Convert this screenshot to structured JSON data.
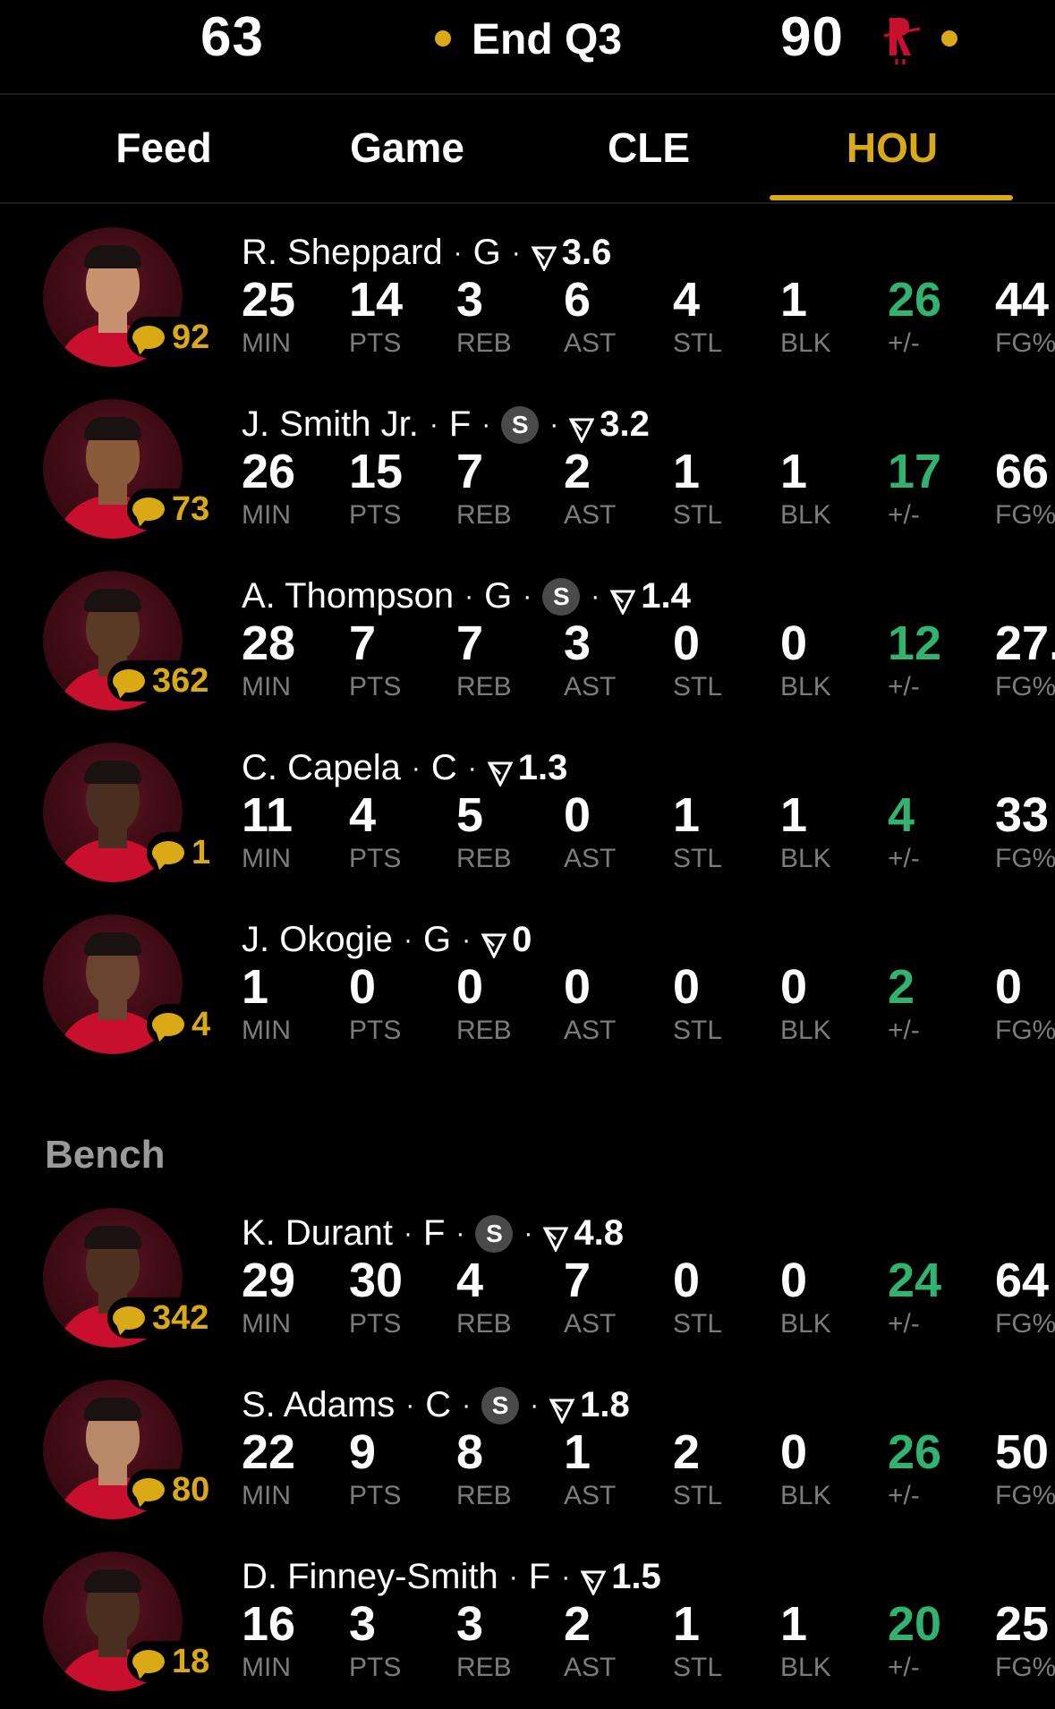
{
  "score": {
    "away": "63",
    "home": "90",
    "period": "End Q3"
  },
  "colors": {
    "accent": "#d9a916",
    "positive": "#2fb36e",
    "label": "#7c7c7c",
    "jersey": "#c8102e"
  },
  "icons": {
    "team_logo": "rockets-logo-icon",
    "comment": "speech-bubble-icon",
    "rating": "rating-flag-icon",
    "starter": "s-badge"
  },
  "tabs": [
    {
      "label": "Feed"
    },
    {
      "label": "Game"
    },
    {
      "label": "CLE"
    },
    {
      "label": "HOU",
      "active": true
    }
  ],
  "stat_labels": [
    "MIN",
    "PTS",
    "REB",
    "AST",
    "STL",
    "BLK",
    "+/-",
    "FG%"
  ],
  "bench_label": "Bench",
  "starters": [
    {
      "name": "R. Sheppard",
      "pos": "G",
      "badge": "",
      "rating": "3.6",
      "comments": "92",
      "stats": [
        "25",
        "14",
        "3",
        "6",
        "4",
        "1",
        "26",
        "44"
      ]
    },
    {
      "name": "J. Smith Jr.",
      "pos": "F",
      "badge": "S",
      "rating": "3.2",
      "comments": "73",
      "stats": [
        "26",
        "15",
        "7",
        "2",
        "1",
        "1",
        "17",
        "66"
      ]
    },
    {
      "name": "A. Thompson",
      "pos": "G",
      "badge": "S",
      "rating": "1.4",
      "comments": "362",
      "stats": [
        "28",
        "7",
        "7",
        "3",
        "0",
        "0",
        "12",
        "27."
      ]
    },
    {
      "name": "C. Capela",
      "pos": "C",
      "badge": "",
      "rating": "1.3",
      "comments": "1",
      "stats": [
        "11",
        "4",
        "5",
        "0",
        "1",
        "1",
        "4",
        "33"
      ]
    },
    {
      "name": "J. Okogie",
      "pos": "G",
      "badge": "",
      "rating": "0",
      "comments": "4",
      "stats": [
        "1",
        "0",
        "0",
        "0",
        "0",
        "0",
        "2",
        "0"
      ]
    }
  ],
  "bench": [
    {
      "name": "K. Durant",
      "pos": "F",
      "badge": "S",
      "rating": "4.8",
      "comments": "342",
      "stats": [
        "29",
        "30",
        "4",
        "7",
        "0",
        "0",
        "24",
        "64"
      ]
    },
    {
      "name": "S. Adams",
      "pos": "C",
      "badge": "S",
      "rating": "1.8",
      "comments": "80",
      "stats": [
        "22",
        "9",
        "8",
        "1",
        "2",
        "0",
        "26",
        "50"
      ]
    },
    {
      "name": "D. Finney-Smith",
      "pos": "F",
      "badge": "",
      "rating": "1.5",
      "comments": "18",
      "stats": [
        "16",
        "3",
        "3",
        "2",
        "1",
        "1",
        "20",
        "25"
      ]
    }
  ]
}
